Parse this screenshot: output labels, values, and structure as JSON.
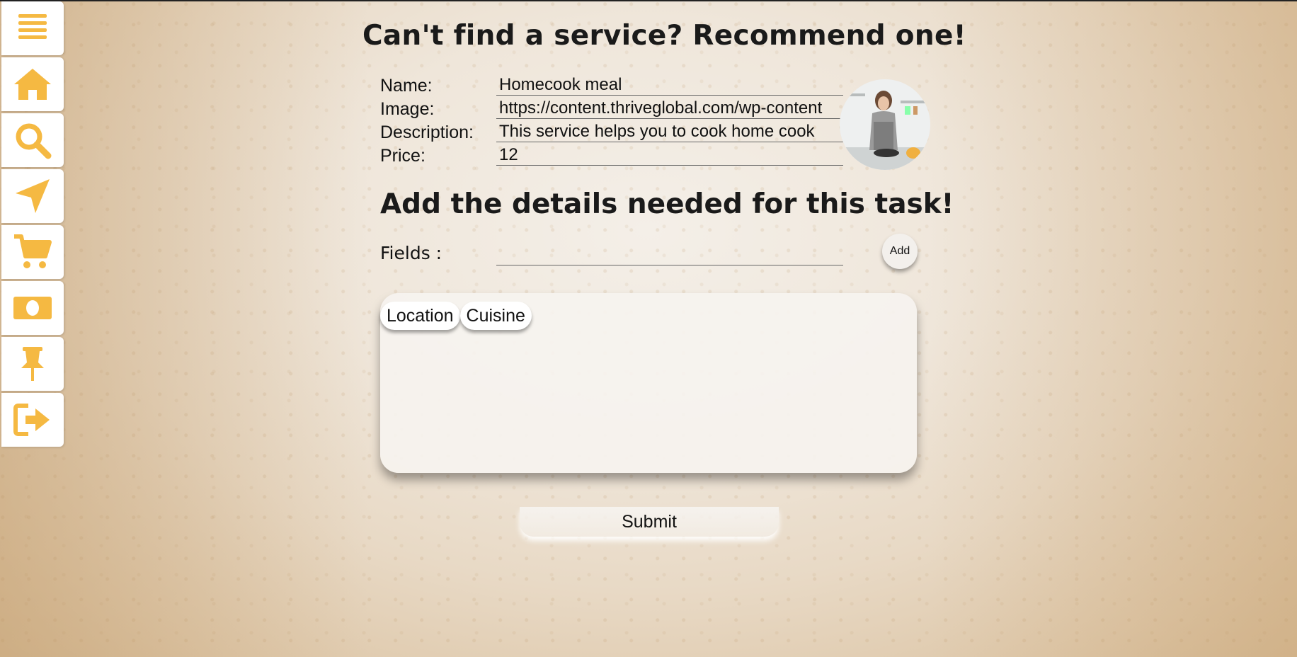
{
  "colors": {
    "accent": "#f5b942",
    "text": "#111111",
    "panel": "#f6f3ef"
  },
  "sidebar": {
    "items": [
      {
        "icon": "menu-icon"
      },
      {
        "icon": "home-icon"
      },
      {
        "icon": "search-icon"
      },
      {
        "icon": "location-arrow-icon"
      },
      {
        "icon": "cart-icon"
      },
      {
        "icon": "money-icon"
      },
      {
        "icon": "pin-icon"
      },
      {
        "icon": "logout-icon"
      }
    ]
  },
  "header": {
    "title": "Can't find a service? Recommend one!"
  },
  "form": {
    "name_label": "Name:",
    "name_value": "Homecook meal",
    "image_label": "Image:",
    "image_value": "https://content.thriveglobal.com/wp-content",
    "description_label": "Description:",
    "description_value": "This service helps you to cook home cook",
    "price_label": "Price:",
    "price_value": "12"
  },
  "details": {
    "title": "Add the details needed for this task!",
    "fields_label": "Fields :",
    "fields_value": "",
    "add_label": "Add",
    "tags": [
      "Location",
      "Cuisine"
    ]
  },
  "submit_label": "Submit"
}
